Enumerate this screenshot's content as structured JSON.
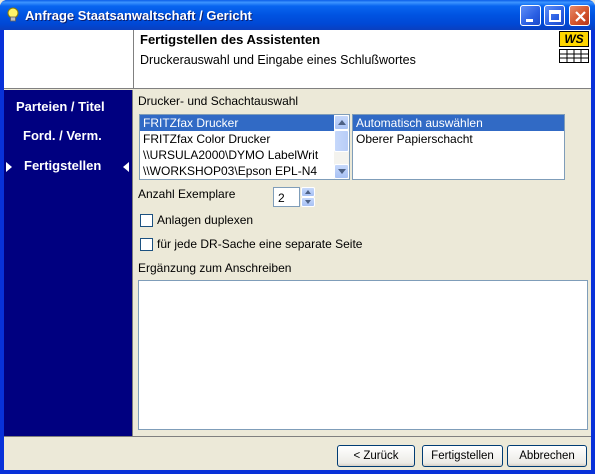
{
  "window": {
    "title": "Anfrage Staatsanwaltschaft / Gericht"
  },
  "header": {
    "title": "Fertigstellen des Assistenten",
    "subtitle": "Druckerauswahl und Eingabe eines Schlußwortes",
    "logo_text": "WS"
  },
  "sidebar": {
    "items": [
      {
        "label": "Parteien / Titel"
      },
      {
        "label": "Ford. / Verm."
      },
      {
        "label": "Fertigstellen"
      }
    ]
  },
  "main": {
    "printer_label": "Drucker- und Schachtauswahl",
    "printers": [
      "FRITZfax Drucker",
      "FRITZfax Color Drucker",
      "\\\\URSULA2000\\DYMO LabelWrit",
      "\\\\WORKSHOP03\\Epson EPL-N4"
    ],
    "trays": [
      "Automatisch auswählen",
      "Oberer Papierschacht"
    ],
    "copies_label": "Anzahl Exemplare",
    "copies_value": "2",
    "duplex_label": "Anlagen duplexen",
    "separate_label": "für jede DR-Sache eine separate Seite",
    "note_label": "Ergänzung zum Anschreiben"
  },
  "footer": {
    "back": "< Zurück",
    "finish": "Fertigstellen",
    "cancel": "Abbrechen"
  }
}
